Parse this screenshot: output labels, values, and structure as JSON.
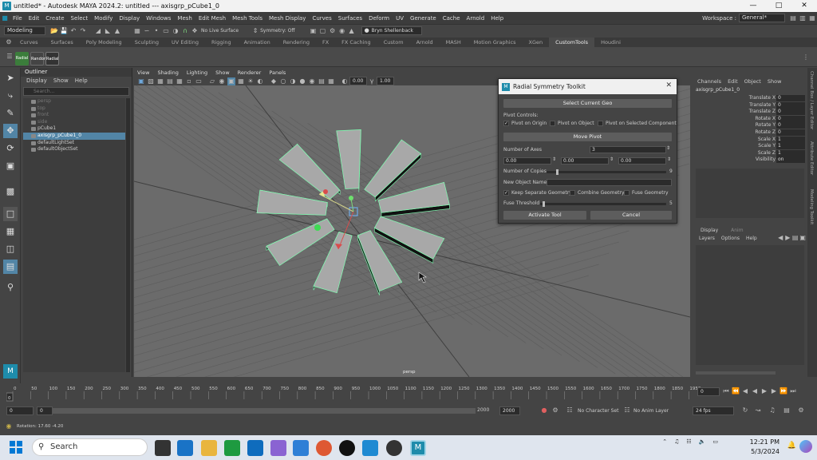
{
  "window": {
    "title": "untitled* - Autodesk MAYA 2024.2: untitled   ---   axisgrp_pCube1_0",
    "app_icon": "M",
    "controls": [
      "minimize-icon",
      "maximize-icon",
      "close-icon"
    ]
  },
  "menu": {
    "items": [
      "File",
      "Edit",
      "Create",
      "Select",
      "Modify",
      "Display",
      "Windows",
      "Mesh",
      "Edit Mesh",
      "Mesh Tools",
      "Mesh Display",
      "Curves",
      "Surfaces",
      "Deform",
      "UV",
      "Generate",
      "Cache",
      "Arnold",
      "Help"
    ],
    "workspace_label": "Workspace :",
    "workspace_value": "General*"
  },
  "status_line": {
    "mode": "Modeling",
    "live_surface": "No Live Surface",
    "symmetry": "Symmetry: Off",
    "user": "Bryn Shellenback"
  },
  "shelf": {
    "tabs": [
      "Curves",
      "Surfaces",
      "Poly Modeling",
      "Sculpting",
      "UV Editing",
      "Rigging",
      "Animation",
      "Rendering",
      "FX",
      "FX Caching",
      "Custom",
      "Arnold",
      "MASH",
      "Motion Graphics",
      "XGen",
      "CustomTools",
      "Houdini"
    ],
    "active_tab": "CustomTools",
    "buttons": [
      "Radial",
      "Random"
    ]
  },
  "outliner": {
    "title": "Outliner",
    "menu": [
      "Display",
      "Show",
      "Help"
    ],
    "search_placeholder": "Search...",
    "items": [
      {
        "label": "persp",
        "state": "dim"
      },
      {
        "label": "top",
        "state": "dim"
      },
      {
        "label": "front",
        "state": "dim"
      },
      {
        "label": "side",
        "state": "dim"
      },
      {
        "label": "pCube1",
        "state": "normal"
      },
      {
        "label": "axisgrp_pCube1_0",
        "state": "selected"
      },
      {
        "label": "defaultLightSet",
        "state": "normal"
      },
      {
        "label": "defaultObjectSet",
        "state": "normal"
      }
    ]
  },
  "viewport": {
    "menu": [
      "View",
      "Shading",
      "Lighting",
      "Show",
      "Renderer",
      "Panels"
    ],
    "field_1": "0.00",
    "field_2": "1.00",
    "camera_label": "persp"
  },
  "dialog": {
    "title": "Radial Symmetry Toolkit",
    "select_button": "Select Current Geo",
    "pivot_controls_label": "Pivot Controls:",
    "pivot_options": [
      {
        "label": "Pivot on Origin",
        "checked": true
      },
      {
        "label": "Pivot on Object",
        "checked": false
      },
      {
        "label": "Pivot on Selected Component",
        "checked": false
      }
    ],
    "move_pivot_button": "Move Pivot",
    "axes_label": "Number of Axes",
    "axes_value": "3",
    "pivot_values": [
      "0.00",
      "0.00",
      "0.00"
    ],
    "copies_label": "Number of Copies",
    "copies_value": "9",
    "new_name_label": "New Object Name",
    "geometry_options": [
      {
        "label": "Keep Separate Geometry",
        "checked": true
      },
      {
        "label": "Combine Geometry",
        "checked": false
      },
      {
        "label": "Fuse Geometry",
        "checked": false
      }
    ],
    "fuse_label": "Fuse Threshold",
    "fuse_value": "5",
    "activate_button": "Activate Tool",
    "cancel_button": "Cancel"
  },
  "channel_box": {
    "menu": [
      "Channels",
      "Edit",
      "Object",
      "Show"
    ],
    "object_name": "axisgrp_pCube1_0",
    "channels": [
      {
        "name": "Translate X",
        "value": "0"
      },
      {
        "name": "Translate Y",
        "value": "0"
      },
      {
        "name": "Translate Z",
        "value": "0"
      },
      {
        "name": "Rotate X",
        "value": "0"
      },
      {
        "name": "Rotate Y",
        "value": "0"
      },
      {
        "name": "Rotate Z",
        "value": "0"
      },
      {
        "name": "Scale X",
        "value": "1"
      },
      {
        "name": "Scale Y",
        "value": "1"
      },
      {
        "name": "Scale Z",
        "value": "1"
      },
      {
        "name": "Visibility",
        "value": "on"
      }
    ],
    "side_labels": [
      "Channel Box / Layer Editor",
      "Attribute Editor",
      "Modeling Toolkit"
    ]
  },
  "layers": {
    "tabs": [
      "Display",
      "Anim"
    ],
    "menu": [
      "Layers",
      "Options",
      "Help"
    ]
  },
  "timeline": {
    "ticks": [
      "0",
      "50",
      "100",
      "150",
      "200",
      "250",
      "300",
      "350",
      "400",
      "450",
      "500",
      "550",
      "600",
      "650",
      "700",
      "750",
      "800",
      "850",
      "900",
      "950",
      "1000",
      "1050",
      "1100",
      "1150",
      "1200",
      "1250",
      "1300",
      "1350",
      "1400",
      "1450",
      "1500",
      "1550",
      "1600",
      "1650",
      "1700",
      "1750",
      "1800",
      "1850",
      "1950"
    ],
    "current_frame": "0",
    "current_frame_left": "0"
  },
  "range": {
    "start": "0",
    "inner_start": "0",
    "inner_end": "2000",
    "end": "2000",
    "character_set": "No Character Set",
    "anim_layer": "No Anim Layer",
    "fps": "24 fps"
  },
  "help_line": {
    "text": "Rotation:   17.60   -4.20"
  },
  "taskbar": {
    "search": "Search",
    "time": "12:21 PM",
    "date": "5/3/2024"
  },
  "colors": {
    "selection": "#5285a6",
    "viewport_bg": "#6b6b6b",
    "mesh_face": "#a8a8a8",
    "mesh_edge": "#7fffb2",
    "maya_brand": "#1e8cab"
  }
}
